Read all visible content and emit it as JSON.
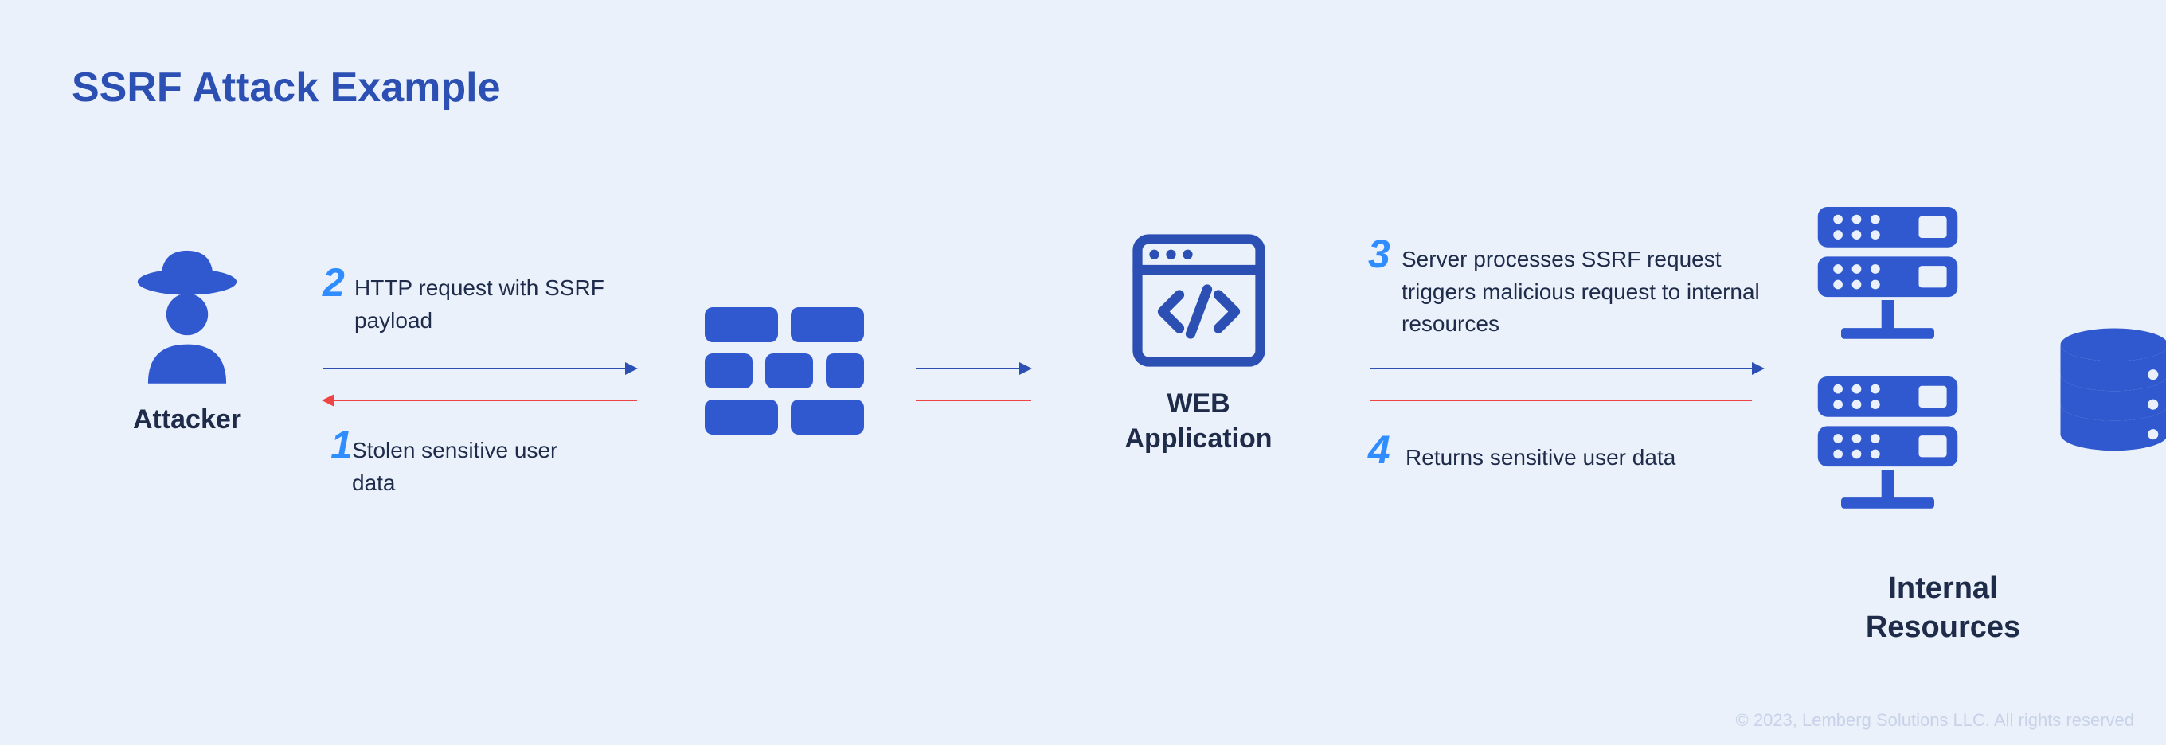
{
  "title": "SSRF Attack Example",
  "nodes": {
    "attacker": "Attacker",
    "webapp_line1": "WEB",
    "webapp_line2": "Application",
    "internal_line1": "Internal",
    "internal_line2": "Resources"
  },
  "steps": {
    "s1": {
      "num": "1",
      "text": "Stolen sensitive user data"
    },
    "s2": {
      "num": "2",
      "text": "HTTP request with SSRF payload"
    },
    "s3": {
      "num": "3",
      "text": "Server processes SSRF request triggers malicious request to internal resources"
    },
    "s4": {
      "num": "4",
      "text": "Returns sensitive user data"
    }
  },
  "copyright": "© 2023, Lemberg Solutions LLC. All rights reserved",
  "colors": {
    "blue": "#2b4fb2",
    "accent": "#2f8dff",
    "red": "#ef4444",
    "text": "#1e2c4a",
    "bg": "#eaf1fb"
  }
}
